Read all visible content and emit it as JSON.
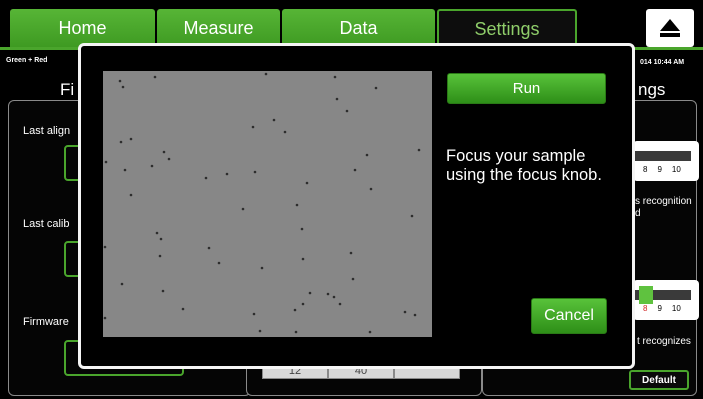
{
  "nav": {
    "tabs": [
      {
        "label": "Home"
      },
      {
        "label": "Measure"
      },
      {
        "label": "Data"
      },
      {
        "label": "Settings",
        "active": true
      }
    ],
    "eject_icon": "eject-icon"
  },
  "status": {
    "mode": "Green + Red",
    "datetime": "014  10:44 AM"
  },
  "background": {
    "left_heading": "Fi",
    "right_heading": "ngs",
    "last_align": "Last align",
    "last_calib": "Last calib",
    "firmware": "Firmware",
    "recognition_text_1": "s recognition",
    "recognition_text_2": "d",
    "recognizes_text": "t recognizes",
    "slider1_ticks": [
      "8",
      "9",
      "10"
    ],
    "slider2_ticks": [
      "8",
      "9",
      "10"
    ],
    "segments": [
      "12",
      "40",
      ""
    ],
    "default_label": "Default"
  },
  "modal": {
    "run_label": "Run",
    "instruction": "Focus your sample using the focus knob.",
    "cancel_label": "Cancel"
  },
  "colors": {
    "accent_green": "#45a028",
    "camera_gray": "#878787"
  }
}
